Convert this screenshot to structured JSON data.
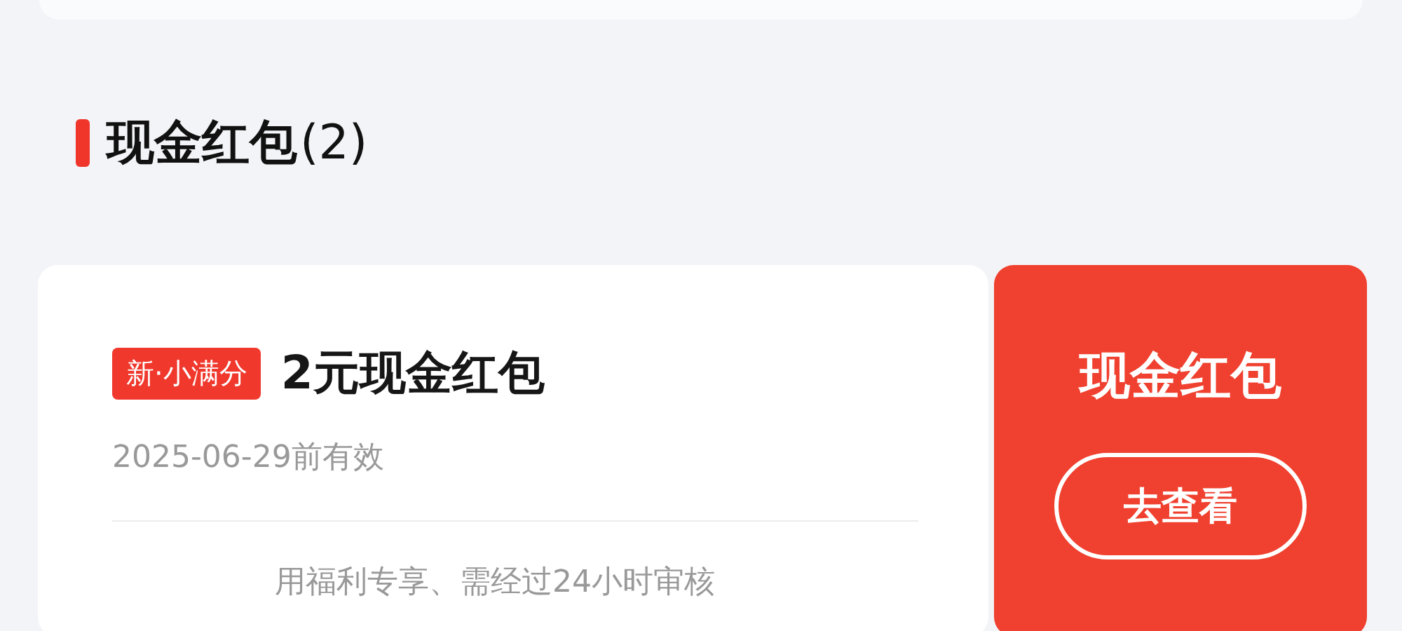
{
  "section": {
    "title": "现金红包",
    "count": "(2)"
  },
  "coupons": [
    {
      "tag": "新·小满分",
      "title": "2元现金红包",
      "validity": "2025-06-29前有效",
      "note": "用福利专享、需经过24小时审核",
      "side_title": "现金红包",
      "action": "去查看"
    }
  ]
}
